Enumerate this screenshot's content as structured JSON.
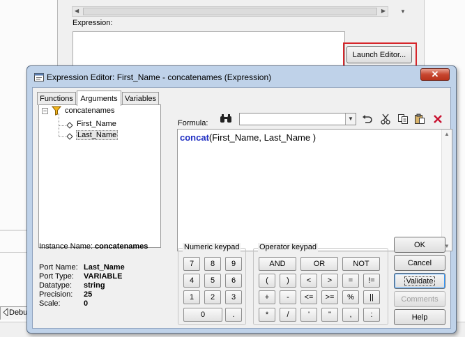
{
  "background": {
    "expression_label": "Expression:",
    "launch_editor_label": "Launch Editor...",
    "debug_tab_label": "Debug"
  },
  "dialog": {
    "title": "Expression Editor: First_Name - concatenames (Expression)",
    "close_glyph": "✕",
    "tabs": [
      {
        "label": "Functions",
        "active": false
      },
      {
        "label": "Arguments",
        "active": true
      },
      {
        "label": "Variables",
        "active": false
      }
    ],
    "tree": {
      "root": "concatenames",
      "children": [
        "First_Name",
        "Last_Name"
      ],
      "selected": "Last_Name"
    },
    "instance": {
      "label": "Instance Name:",
      "value": "concatenames"
    },
    "port_info": {
      "labels": [
        "Port Name:",
        "Port Type:",
        "Datatype:",
        "Precision:",
        "Scale:"
      ],
      "values": [
        "Last_Name",
        "VARIABLE",
        "string",
        "25",
        "0"
      ]
    },
    "formula": {
      "label": "Formula:",
      "search_value": "",
      "function": "concat",
      "args": "(First_Name, Last_Name )"
    },
    "toolbar_icons": [
      "binoculars-icon",
      "undo-icon",
      "cut-icon",
      "copy-icon",
      "paste-icon",
      "delete-icon"
    ],
    "numeric_keypad": {
      "title": "Numeric keypad",
      "keys": [
        "7",
        "8",
        "9",
        "4",
        "5",
        "6",
        "1",
        "2",
        "3",
        "0",
        "."
      ]
    },
    "operator_keypad": {
      "title": "Operator keypad",
      "logic_keys": [
        "AND",
        "OR",
        "NOT"
      ],
      "keys": [
        "(",
        ")",
        "<",
        ">",
        "=",
        "!=",
        "+",
        "-",
        "<=",
        ">=",
        "%",
        "||",
        "*",
        "/",
        "'",
        "\"",
        ",",
        ":"
      ]
    },
    "buttons": {
      "ok": "OK",
      "cancel": "Cancel",
      "validate": "Validate",
      "comments": "Comments",
      "help": "Help"
    },
    "colors": {
      "function_keyword": "#1f2ec2",
      "highlight_box": "#d6262b",
      "delete_icon": "#c8102e"
    }
  }
}
